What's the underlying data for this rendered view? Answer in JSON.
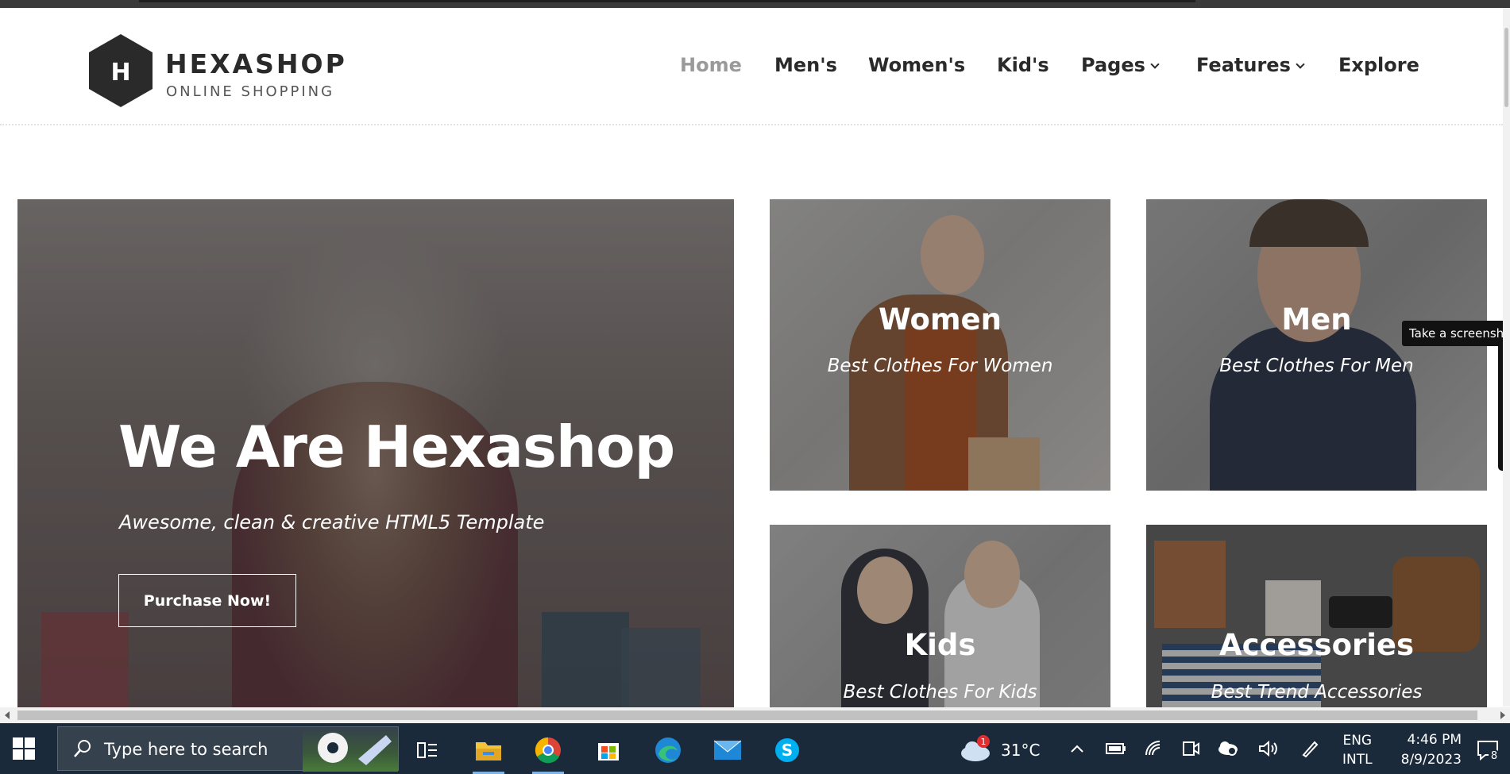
{
  "site": {
    "brand": "HEXASHOP",
    "tagline": "ONLINE SHOPPING",
    "logo_letter": "H"
  },
  "nav": {
    "items": [
      {
        "label": "Home",
        "active": true,
        "dropdown": false
      },
      {
        "label": "Men's",
        "active": false,
        "dropdown": false
      },
      {
        "label": "Women's",
        "active": false,
        "dropdown": false
      },
      {
        "label": "Kid's",
        "active": false,
        "dropdown": false
      },
      {
        "label": "Pages",
        "active": false,
        "dropdown": true
      },
      {
        "label": "Features",
        "active": false,
        "dropdown": true
      },
      {
        "label": "Explore",
        "active": false,
        "dropdown": false
      }
    ]
  },
  "hero": {
    "title": "We Are Hexashop",
    "subtitle": "Awesome, clean & creative HTML5 Template",
    "button": "Purchase Now!"
  },
  "categories": [
    {
      "title": "Women",
      "subtitle": "Best Clothes For Women"
    },
    {
      "title": "Men",
      "subtitle": "Best Clothes For Men"
    },
    {
      "title": "Kids",
      "subtitle": "Best Clothes For Kids"
    },
    {
      "title": "Accessories",
      "subtitle": "Best Trend Accessories"
    }
  ],
  "overlay": {
    "tooltip": "Take a screenshot"
  },
  "taskbar": {
    "search_placeholder": "Type here to search",
    "apps": [
      "task-view",
      "file-explorer",
      "chrome",
      "microsoft-store",
      "edge",
      "mail",
      "skype"
    ],
    "weather_badge": "1",
    "weather_temp": "31°C",
    "lang_top": "ENG",
    "lang_bottom": "INTL",
    "time": "4:46 PM",
    "date": "8/9/2023",
    "notifications_count": "8"
  },
  "colors": {
    "text_dark": "#2a2a2a",
    "nav_active": "#9a9a9a",
    "taskbar_bg": "#1b2a3a"
  }
}
